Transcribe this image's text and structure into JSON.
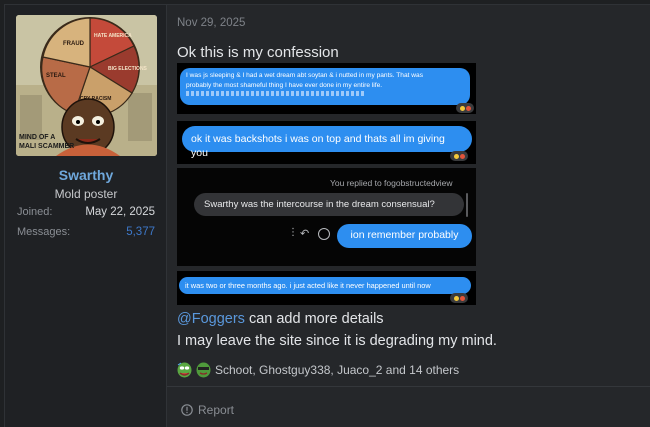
{
  "post": {
    "author": {
      "username": "Swarthy",
      "title": "Mold poster",
      "stats": [
        {
          "label": "Joined:",
          "value": "May 22, 2025"
        },
        {
          "label": "Messages:",
          "value": "5,377"
        }
      ],
      "avatar_text": {
        "slices": [
          "FRAUD",
          "HATE AMERICA",
          "BIG ELECTIONS",
          "CRY RACISM",
          "STEAL"
        ],
        "caption_line1": "MIND OF A",
        "caption_line2": "MALI SCAMMER"
      }
    },
    "date": "Nov 29, 2025",
    "intro": "Ok this is my confession",
    "screenshots": {
      "shot1": {
        "line1": "I was js sleeping & I had a wet dream abt soytan & i nutted in my pants. That was",
        "line2": "probably the most shameful thing I have ever done in my entire life."
      },
      "shot2": {
        "text": "ok it was backshots i was on top and thats all im giving you"
      },
      "shot3": {
        "reply_note": "You replied to fogobstructedview",
        "quoted": "Swarthy was the intercourse in the dream consensual?",
        "response": "ion remember probably"
      },
      "shot4": {
        "text": "it was two or three months ago. i just acted like it never happened until now"
      }
    },
    "closing": {
      "mention": "@Foggers",
      "line1_rest": " can add more details",
      "line2": "I may leave the site since it is degrading my mind."
    },
    "reactions": {
      "summary": "Schoot, Ghostguy338, Juaco_2 and 14 others",
      "icons": [
        "pepe-laugh-icon",
        "pepe-cool-icon"
      ]
    },
    "actions": {
      "report": "Report"
    }
  },
  "colors": {
    "background": "#25272a",
    "accent_username": "#6fa8dc",
    "bubble_blue": "#2d8ef0",
    "mention": "#5a98dc"
  }
}
